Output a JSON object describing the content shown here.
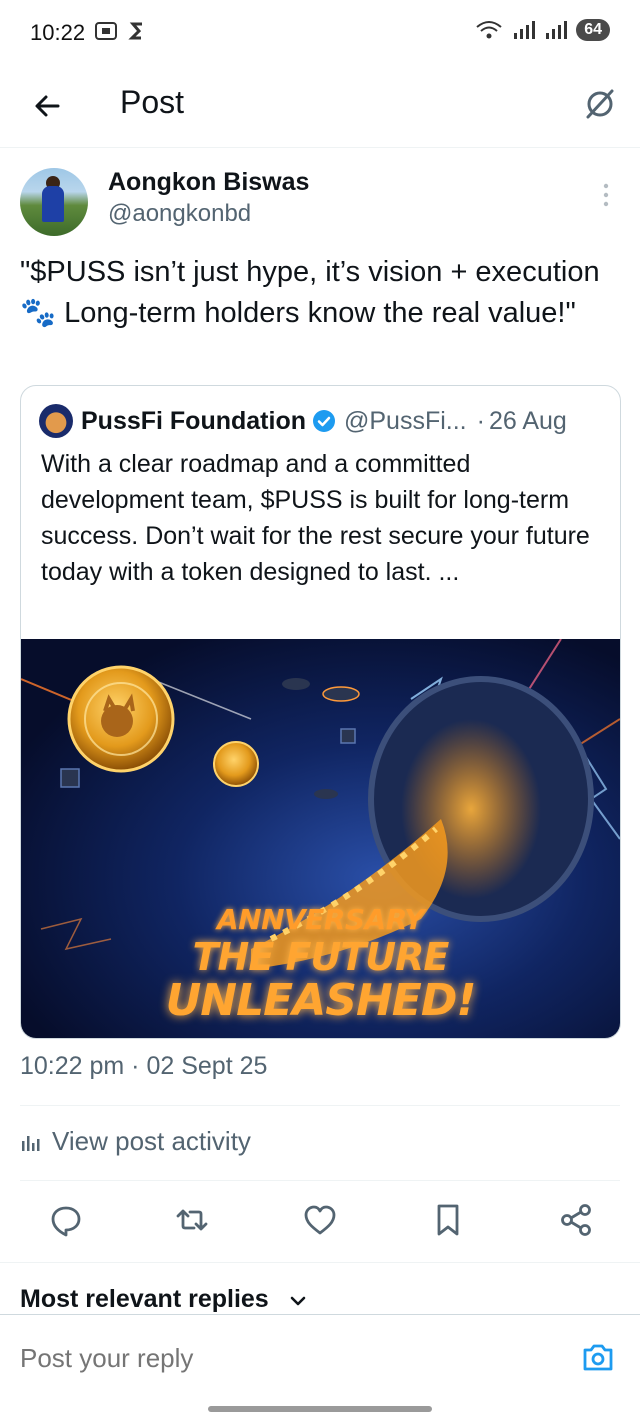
{
  "status_bar": {
    "time": "10:22",
    "battery": "64"
  },
  "header": {
    "title": "Post"
  },
  "post": {
    "author_name": "Aongkon Biswas",
    "author_handle": "@aongkonbd",
    "text": "\"$PUSS isn’t just hype, it’s vision + execution 🐾 Long-term holders know the real value!\"",
    "timestamp": "10:22 pm · 02 Sept 25"
  },
  "quote": {
    "name": "PussFi Foundation",
    "handle": "@PussFi...",
    "separator": "·",
    "date": "26 Aug",
    "text": "With a clear roadmap and a committed development team, $PUSS is built for long-term success. Don’t wait for the rest secure your future today with a token designed to last. ...",
    "image_lines": [
      "ANNVERSARY",
      "THE FUTURE",
      "UNLEASHED!"
    ]
  },
  "activity": {
    "label": "View post activity"
  },
  "actions": [
    "reply-icon",
    "repost-icon",
    "like-icon",
    "bookmark-icon",
    "share-icon"
  ],
  "replies": {
    "label": "Most relevant replies"
  },
  "reply_bar": {
    "placeholder": "Post your reply"
  },
  "colors": {
    "text": "#0f1419",
    "secondary": "#536471",
    "accent": "#1d9bf0",
    "border": "#cfd9de"
  }
}
